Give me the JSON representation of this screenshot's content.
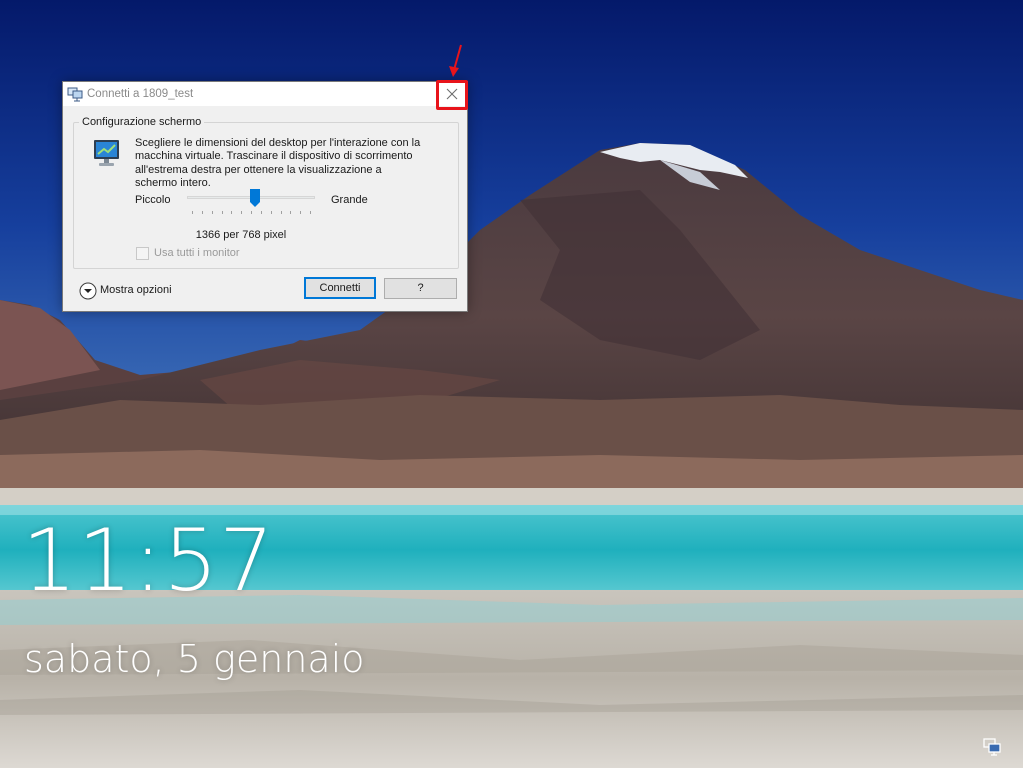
{
  "lockscreen": {
    "time": "11:57",
    "date": "sabato, 5 gennaio",
    "network_icon": "network-icon"
  },
  "dialog": {
    "title": "Connetti a 1809_test",
    "title_icon": "remote-desktop-icon",
    "close_icon": "close-icon",
    "group_label": "Configurazione schermo",
    "description": "Scegliere le dimensioni del desktop per l'interazione con la macchina virtuale. Trascinare il dispositivo di scorrimento all'estrema destra per ottenere la visualizzazione a schermo intero.",
    "slider": {
      "min_label": "Piccolo",
      "max_label": "Grande",
      "position": 0.53,
      "tick_count": 13
    },
    "resolution": "1366 per 768 pixel",
    "use_all_monitors_label": "Usa tutti i monitor",
    "use_all_monitors_checked": false,
    "show_options_label": "Mostra opzioni",
    "connect_label": "Connetti",
    "help_label": "?"
  },
  "colors": {
    "annotation": "#e8141b",
    "focus_border": "#0078d7",
    "slider_thumb": "#0078d7"
  }
}
